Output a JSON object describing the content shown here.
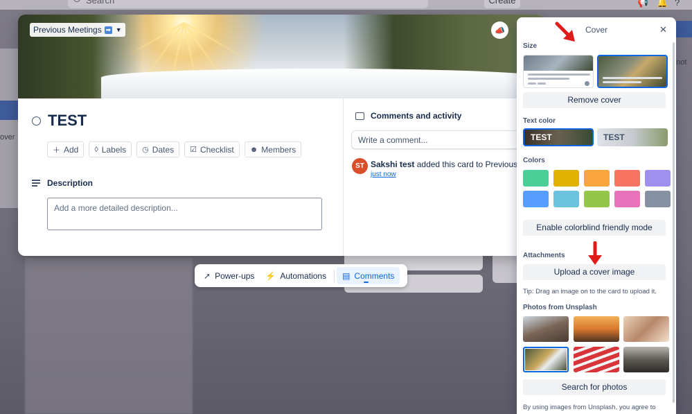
{
  "background": {
    "search_placeholder": "Search",
    "create_label": "Create",
    "left_fragment": "over",
    "right_fragment": "anot"
  },
  "card": {
    "list_chip": "Previous Meetings",
    "list_chip_emoji": "➡",
    "title": "TEST",
    "actions": [
      {
        "icon": "plus-icon",
        "label": "Add"
      },
      {
        "icon": "tag-icon",
        "label": "Labels"
      },
      {
        "icon": "clock-icon",
        "label": "Dates"
      },
      {
        "icon": "checkbox-icon",
        "label": "Checklist"
      },
      {
        "icon": "person-icon",
        "label": "Members"
      }
    ],
    "description_label": "Description",
    "description_placeholder": "Add a more detailed description...",
    "comments_label": "Comments and activity",
    "comment_placeholder": "Write a comment...",
    "activity": {
      "avatar_initials": "ST",
      "user": "Sakshi test",
      "text": "added this card to Previous Meetings",
      "time": "just now"
    }
  },
  "toolbar": {
    "powerups": "Power-ups",
    "automations": "Automations",
    "comments": "Comments"
  },
  "cover_panel": {
    "title": "Cover",
    "size_label": "Size",
    "remove_cover": "Remove cover",
    "text_color_label": "Text color",
    "text_dark_sample": "TEST",
    "text_light_sample": "TEST",
    "colors_label": "Colors",
    "colors": [
      "#4bce97",
      "#e2b203",
      "#faa53d",
      "#f87462",
      "#9f8fef",
      "#579dff",
      "#6cc3e0",
      "#94c748",
      "#e774bb",
      "#8590a2"
    ],
    "colorblind_button": "Enable colorblind friendly mode",
    "attachments_label": "Attachments",
    "upload_button": "Upload a cover image",
    "tip": "Tip: Drag an image on to the card to upload it.",
    "unsplash_label": "Photos from Unsplash",
    "search_photos": "Search for photos",
    "legal": "By using images from Unsplash, you agree to"
  },
  "accent_colors": {
    "selection": "#0c66e4",
    "arrow": "#e01b1b"
  }
}
